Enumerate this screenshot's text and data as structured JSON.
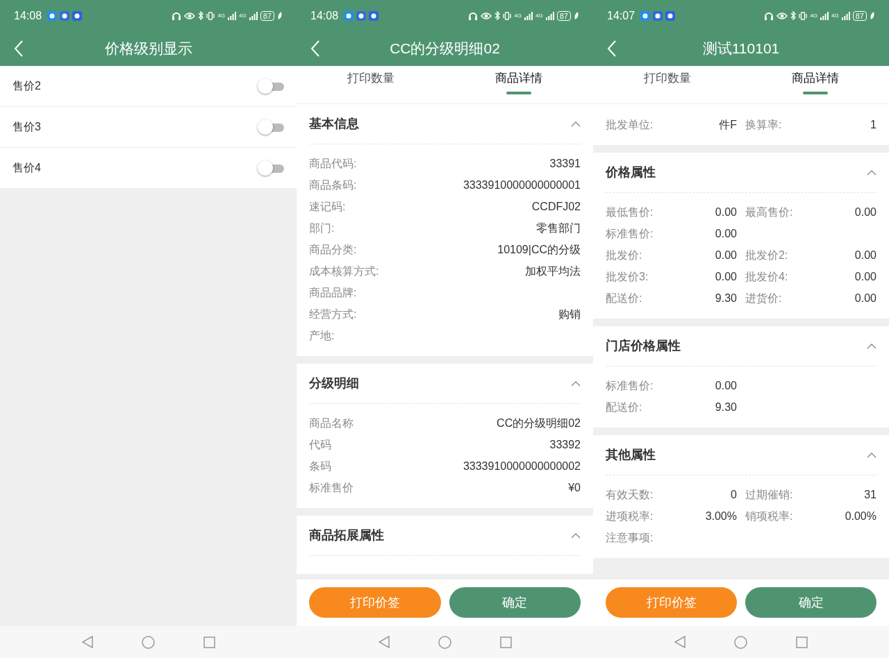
{
  "screens": [
    {
      "kind": "settings",
      "status_bar": {
        "time": "14:08",
        "network": [
          "4G",
          "4G"
        ],
        "battery": "87"
      },
      "title": "价格级别显示",
      "toggles": [
        {
          "label": "售价2",
          "on": false
        },
        {
          "label": "售价3",
          "on": false
        },
        {
          "label": "售价4",
          "on": false
        }
      ]
    },
    {
      "kind": "detail",
      "status_bar": {
        "time": "14:08",
        "network": [
          "4G",
          "4G"
        ],
        "battery": "87"
      },
      "title": "CC的分级明细02",
      "tabs": [
        {
          "label": "打印数量",
          "selected": false
        },
        {
          "label": "商品详情",
          "selected": true
        }
      ],
      "sections": [
        {
          "title": "基本信息",
          "expanded": true,
          "rows": [
            [
              {
                "label": "商品代码:",
                "value": "33391"
              }
            ],
            [
              {
                "label": "商品条码:",
                "value": "3333910000000000001"
              }
            ],
            [
              {
                "label": "速记码:",
                "value": "CCDFJ02"
              }
            ],
            [
              {
                "label": "部门:",
                "value": "零售部门"
              }
            ],
            [
              {
                "label": "商品分类:",
                "value": "10109|CC的分级"
              }
            ],
            [
              {
                "label": "成本核算方式:",
                "value": "加权平均法"
              }
            ],
            [
              {
                "label": "商品品牌:"
              }
            ],
            [
              {
                "label": "经营方式:",
                "value": "购销"
              }
            ],
            [
              {
                "label": "产地:"
              }
            ]
          ]
        },
        {
          "title": "分级明细",
          "expanded": true,
          "rows": [
            [
              {
                "label": "商品名称",
                "value": "CC的分级明细02"
              }
            ],
            [
              {
                "label": "代码",
                "value": "33392"
              }
            ],
            [
              {
                "label": "条码",
                "value": "3333910000000000002"
              }
            ],
            [
              {
                "label": "标准售价",
                "value": "¥0"
              }
            ]
          ]
        },
        {
          "title": "商品拓展属性",
          "expanded": true
        }
      ],
      "buttons": [
        {
          "label": "打印价签",
          "kind": "secondary"
        },
        {
          "label": "确定",
          "kind": "primary"
        }
      ]
    },
    {
      "kind": "detail",
      "status_bar": {
        "time": "14:07",
        "network": [
          "4G",
          "4G"
        ],
        "battery": "87"
      },
      "title": "测试110101",
      "tabs": [
        {
          "label": "打印数量",
          "selected": false
        },
        {
          "label": "商品详情",
          "selected": true
        }
      ],
      "sections": [
        {
          "rows": [
            [
              {
                "label": "批发单位:",
                "value": "件F"
              },
              {
                "label": "换算率:",
                "value": "1"
              }
            ]
          ]
        },
        {
          "title": "价格属性",
          "expanded": true,
          "rows": [
            [
              {
                "label": "最低售价:",
                "value": "0.00"
              },
              {
                "label": "最高售价:",
                "value": "0.00"
              }
            ],
            [
              {
                "label": "标准售价:",
                "value": "0.00"
              }
            ],
            [
              {
                "label": "批发价:",
                "value": "0.00"
              },
              {
                "label": "批发价2:",
                "value": "0.00"
              }
            ],
            [
              {
                "label": "批发价3:",
                "value": "0.00"
              },
              {
                "label": "批发价4:",
                "value": "0.00"
              }
            ],
            [
              {
                "label": "配送价:",
                "value": "9.30"
              },
              {
                "label": "进货价:",
                "value": "0.00"
              }
            ]
          ]
        },
        {
          "title": "门店价格属性",
          "expanded": true,
          "rows": [
            [
              {
                "label": "标准售价:",
                "value": "0.00"
              }
            ],
            [
              {
                "label": "配送价:",
                "value": "9.30"
              }
            ]
          ]
        },
        {
          "title": "其他属性",
          "expanded": true,
          "rows": [
            [
              {
                "label": "有效天数:",
                "value": "0"
              },
              {
                "label": "过期催销:",
                "value": "31"
              }
            ],
            [
              {
                "label": "进项税率:",
                "value": "3.00%"
              },
              {
                "label": "销项税率:",
                "value": "0.00%"
              }
            ],
            [
              {
                "label": "注意事项:"
              }
            ]
          ]
        }
      ],
      "buttons": [
        {
          "label": "打印价签",
          "kind": "secondary"
        },
        {
          "label": "确定",
          "kind": "primary"
        }
      ]
    }
  ]
}
